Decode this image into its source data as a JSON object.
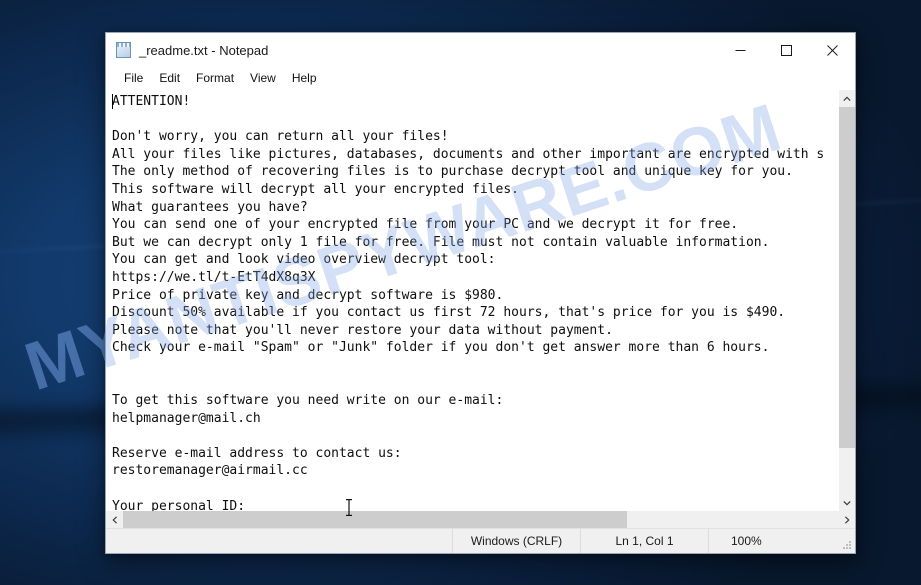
{
  "desktop": {
    "watermark_text": "MYANTISPYWARE.COM",
    "wallpaper_color": "#0d2b52"
  },
  "window": {
    "title": "_readme.txt - Notepad",
    "icon": "notepad-icon",
    "controls": {
      "minimize": "Minimize",
      "maximize": "Maximize",
      "close": "Close"
    }
  },
  "menubar": {
    "items": [
      {
        "label": "File"
      },
      {
        "label": "Edit"
      },
      {
        "label": "Format"
      },
      {
        "label": "View"
      },
      {
        "label": "Help"
      }
    ]
  },
  "document": {
    "filename": "_readme.txt",
    "lines": [
      "ATTENTION!",
      "",
      "Don't worry, you can return all your files!",
      "All your files like pictures, databases, documents and other important are encrypted with s",
      "The only method of recovering files is to purchase decrypt tool and unique key for you.",
      "This software will decrypt all your encrypted files.",
      "What guarantees you have?",
      "You can send one of your encrypted file from your PC and we decrypt it for free.",
      "But we can decrypt only 1 file for free. File must not contain valuable information.",
      "You can get and look video overview decrypt tool:",
      "https://we.tl/t-EtT4dX8q3X",
      "Price of private key and decrypt software is $980.",
      "Discount 50% available if you contact us first 72 hours, that's price for you is $490.",
      "Please note that you'll never restore your data without payment.",
      "Check your e-mail \"Spam\" or \"Junk\" folder if you don't get answer more than 6 hours.",
      "",
      "",
      "To get this software you need write on our e-mail:",
      "helpmanager@mail.ch",
      "",
      "Reserve e-mail address to contact us:",
      "restoremanager@airmail.cc",
      "",
      "Your personal ID:"
    ],
    "ransom_details": {
      "price_full": "$980",
      "price_discount": "$490",
      "discount_percent": "50%",
      "discount_window_hours": "72 hours",
      "response_window_hours": "6 hours",
      "video_url": "https://we.tl/t-EtT4dX8q3X",
      "primary_email": "helpmanager@mail.ch",
      "reserve_email": "restoremanager@airmail.cc"
    }
  },
  "scrollbars": {
    "vertical": {
      "up_arrow": "scroll-up",
      "down_arrow": "scroll-down",
      "thumb_size_pct": 88
    },
    "horizontal": {
      "left_arrow": "scroll-left",
      "right_arrow": "scroll-right",
      "thumb_size_pct": 70.5
    }
  },
  "statusbar": {
    "line_ending": "Windows (CRLF)",
    "cursor_position": "Ln 1, Col 1",
    "zoom_level": "100%"
  }
}
